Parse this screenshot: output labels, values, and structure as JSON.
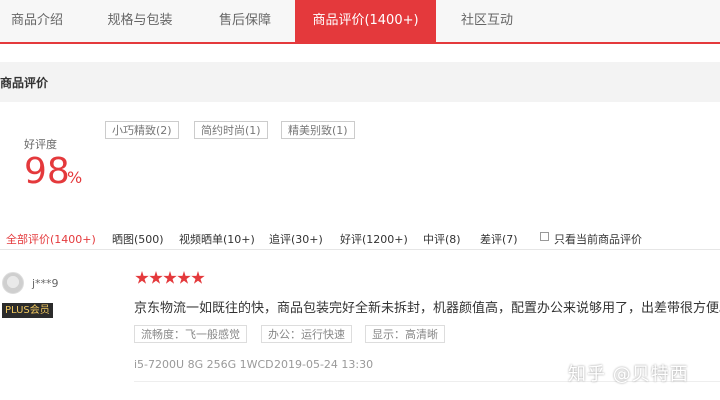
{
  "tabs": [
    {
      "label": "商品介绍"
    },
    {
      "label": "规格与包装"
    },
    {
      "label": "售后保障"
    },
    {
      "label": "商品评价(1400+)",
      "active": true
    },
    {
      "label": "社区互动"
    }
  ],
  "section": {
    "title": "商品评价"
  },
  "rating": {
    "label": "好评度",
    "value": "98",
    "percent_sign": "%",
    "fraction": 0.98
  },
  "impression_tags": [
    {
      "label": "小巧精致(2)"
    },
    {
      "label": "简约时尚(1)"
    },
    {
      "label": "精美别致(1)"
    }
  ],
  "filters": [
    {
      "label": "全部评价(1400+)",
      "active": true
    },
    {
      "label": "晒图(500)"
    },
    {
      "label": "视频晒单(10+)"
    },
    {
      "label": "追评(30+)"
    },
    {
      "label": "好评(1200+)"
    },
    {
      "label": "中评(8)"
    },
    {
      "label": "差评(7)"
    }
  ],
  "only_current": {
    "label": "只看当前商品评价",
    "checked": false
  },
  "review": {
    "username": "j***9",
    "badge": "PLUS会员",
    "stars": 5,
    "text": "京东物流一如既往的快，商品包装完好全新未拆封，机器颜值高，配置办公来说够用了，出差带很方便。",
    "tags": [
      {
        "label": "流畅度：飞一般感觉"
      },
      {
        "label": "办公：运行快速"
      },
      {
        "label": "显示：高清晰"
      }
    ],
    "spec": "i5-7200U 8G 256G 1WCD",
    "date": "2019-05-24 13:30"
  },
  "watermark": "知乎 @贝特西",
  "colors": {
    "accent": "#e4393c",
    "plus_badge_bg": "#2b2b2b",
    "plus_badge_text": "#f0c75e"
  }
}
